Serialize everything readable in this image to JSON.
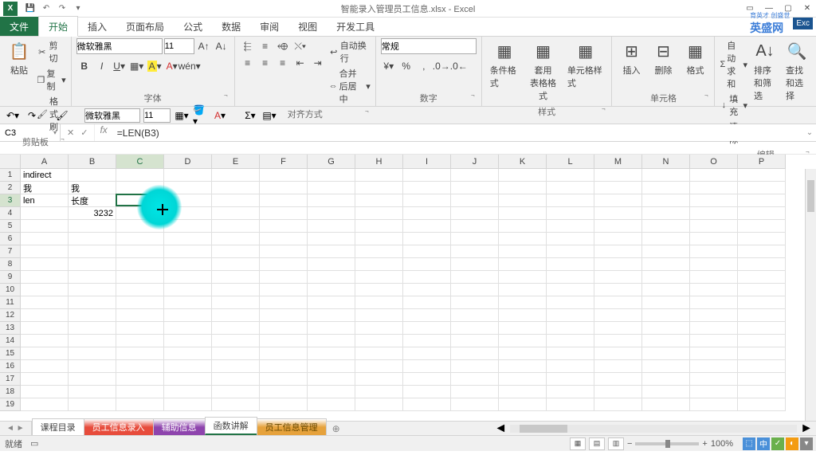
{
  "window": {
    "title": "智能录入管理员工信息.xlsx - Excel",
    "app_abbrev": "X"
  },
  "tabs": {
    "file": "文件",
    "home": "开始",
    "insert": "插入",
    "layout": "页面布局",
    "formulas": "公式",
    "data": "数据",
    "review": "审阅",
    "view": "视图",
    "dev": "开发工具"
  },
  "brand": {
    "main": "英盛网",
    "sub": "育英才 创盛世",
    "badge": "Exc"
  },
  "ribbon": {
    "clipboard": {
      "paste": "粘贴",
      "cut": "剪切",
      "copy": "复制",
      "format_painter": "格式刷",
      "label": "剪贴板"
    },
    "font": {
      "family": "微软雅黑",
      "size": "11",
      "label": "字体"
    },
    "alignment": {
      "wrap": "自动换行",
      "merge": "合并后居中",
      "label": "对齐方式"
    },
    "number": {
      "format": "常规",
      "label": "数字"
    },
    "styles": {
      "cond": "条件格式",
      "table": "套用\n表格格式",
      "cell": "单元格样式",
      "label": "样式"
    },
    "cells": {
      "insert": "插入",
      "delete": "删除",
      "format": "格式",
      "label": "单元格"
    },
    "editing": {
      "autosum": "自动求和",
      "fill": "填充",
      "clear": "清除",
      "sort": "排序和筛选",
      "find": "查找和选择",
      "label": "编辑"
    }
  },
  "subbar": {
    "font": "微软雅黑",
    "size": "11"
  },
  "formula": {
    "name_box": "C3",
    "formula": "=LEN(B3)"
  },
  "columns": [
    "A",
    "B",
    "C",
    "D",
    "E",
    "F",
    "G",
    "H",
    "I",
    "J",
    "K",
    "L",
    "M",
    "N",
    "O",
    "P"
  ],
  "rows": [
    "1",
    "2",
    "3",
    "4",
    "5",
    "6",
    "7",
    "8",
    "9",
    "10",
    "11",
    "12",
    "13",
    "14",
    "15",
    "16",
    "17",
    "18",
    "19"
  ],
  "cells": {
    "A1": "indirect",
    "A2": "我",
    "B2": "我",
    "A3": "len",
    "B3": "长度",
    "C3": "2",
    "B4": "3232"
  },
  "active_cell": {
    "col": 2,
    "row": 2
  },
  "sheets": {
    "list": "课程目录",
    "entry": "员工信息录入",
    "aux": "辅助信息",
    "func": "函数讲解",
    "mgmt": "员工信息管理"
  },
  "status": {
    "ready": "就绪",
    "scroll": "🔲",
    "zoom": "100%"
  },
  "chart_data": null
}
